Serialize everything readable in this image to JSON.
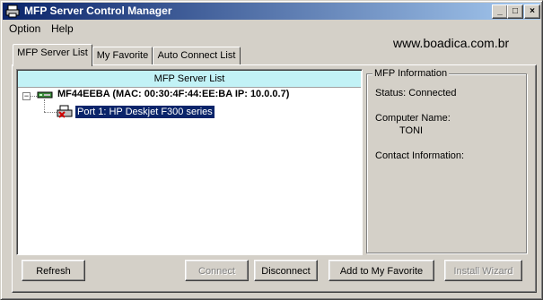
{
  "window": {
    "title": "MFP Server Control Manager",
    "buttons": {
      "minimize": "_",
      "maximize": "□",
      "close": "×"
    }
  },
  "menu": {
    "items": [
      "Option",
      "Help"
    ]
  },
  "watermark": "www.boadica.com.br",
  "tabs": [
    {
      "label": "MFP Server List",
      "active": true
    },
    {
      "label": "My Favorite",
      "active": false
    },
    {
      "label": "Auto Connect List",
      "active": false
    }
  ],
  "server_list": {
    "header": "MFP Server List",
    "expander": "−",
    "root": "MF44EEBA (MAC: 00:30:4F:44:EE:BA   IP: 10.0.0.7)",
    "child": "Port 1: HP Deskjet F300 series"
  },
  "mfp_info": {
    "group_title": "MFP Information",
    "status_line": "Status: Connected",
    "computer_name_label": "Computer Name:",
    "computer_name_value": "TONI",
    "contact_label": "Contact Information:"
  },
  "buttons": {
    "refresh": "Refresh",
    "connect": "Connect",
    "disconnect": "Disconnect",
    "add_favorite": "Add to My Favorite",
    "install_wizard": "Install Wizard"
  },
  "colors": {
    "title_gradient_start": "#0a246a",
    "title_gradient_end": "#a6caf0",
    "list_header_bg": "#c2f2f6",
    "selection_bg": "#0a246a"
  }
}
